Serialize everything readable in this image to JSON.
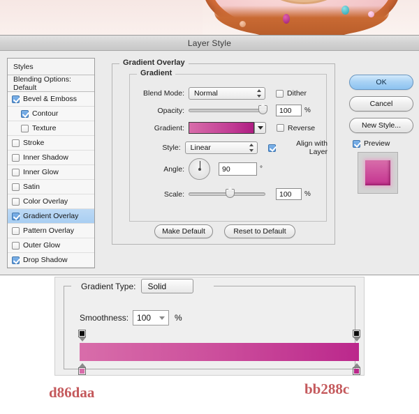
{
  "banner": {
    "alt": "donut-photo"
  },
  "dialog": {
    "title": "Layer Style"
  },
  "styles_panel": {
    "header": "Styles",
    "blending_options": "Blending Options: Default",
    "items": [
      {
        "label": "Bevel & Emboss",
        "checked": true,
        "indent": false,
        "selected": false
      },
      {
        "label": "Contour",
        "checked": true,
        "indent": true,
        "selected": false
      },
      {
        "label": "Texture",
        "checked": false,
        "indent": true,
        "selected": false
      },
      {
        "label": "Stroke",
        "checked": false,
        "indent": false,
        "selected": false
      },
      {
        "label": "Inner Shadow",
        "checked": false,
        "indent": false,
        "selected": false
      },
      {
        "label": "Inner Glow",
        "checked": false,
        "indent": false,
        "selected": false
      },
      {
        "label": "Satin",
        "checked": false,
        "indent": false,
        "selected": false
      },
      {
        "label": "Color Overlay",
        "checked": false,
        "indent": false,
        "selected": false
      },
      {
        "label": "Gradient Overlay",
        "checked": true,
        "indent": false,
        "selected": true
      },
      {
        "label": "Pattern Overlay",
        "checked": false,
        "indent": false,
        "selected": false
      },
      {
        "label": "Outer Glow",
        "checked": false,
        "indent": false,
        "selected": false
      },
      {
        "label": "Drop Shadow",
        "checked": true,
        "indent": false,
        "selected": false
      }
    ]
  },
  "gradient_overlay": {
    "group_title": "Gradient Overlay",
    "subgroup_title": "Gradient",
    "blend_mode_label": "Blend Mode:",
    "blend_mode_value": "Normal",
    "dither_label": "Dither",
    "dither_checked": false,
    "opacity_label": "Opacity:",
    "opacity_value": "100",
    "opacity_unit": "%",
    "gradient_label": "Gradient:",
    "reverse_label": "Reverse",
    "reverse_checked": false,
    "style_label": "Style:",
    "style_value": "Linear",
    "align_label": "Align with Layer",
    "align_checked": true,
    "angle_label": "Angle:",
    "angle_value": "90",
    "angle_unit": "°",
    "scale_label": "Scale:",
    "scale_value": "100",
    "scale_unit": "%",
    "make_default": "Make Default",
    "reset_to_default": "Reset to Default"
  },
  "actions": {
    "ok": "OK",
    "cancel": "Cancel",
    "new_style": "New Style...",
    "preview_label": "Preview",
    "preview_checked": true
  },
  "gradient_editor": {
    "type_label": "Gradient Type:",
    "type_value": "Solid",
    "smoothness_label": "Smoothness:",
    "smoothness_value": "100",
    "smoothness_unit": "%",
    "stop_left_hex": "d86daa",
    "stop_right_hex": "bb288c"
  },
  "colors": {
    "gradient_start": "#d86daa",
    "gradient_end": "#bb288c",
    "hex_label_color": "#c4595c",
    "selection_blue": "#a9cef2",
    "dialog_bg": "#ebebeb"
  }
}
